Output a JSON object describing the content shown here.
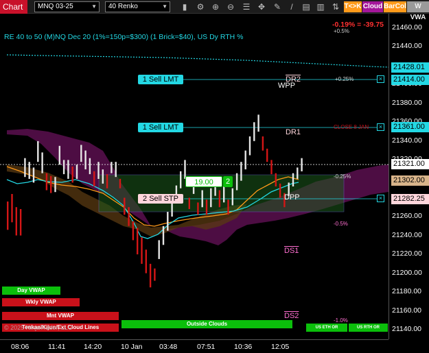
{
  "toolbar": {
    "chart_tab": "Chart",
    "instrument": "MNQ 03-25",
    "bar_type": "40 Renko",
    "buttons": [
      {
        "label": "T<>K",
        "color": "#ff9a1a"
      },
      {
        "label": "Cloud",
        "color": "#a4169a"
      },
      {
        "label": "BarCol",
        "color": "#ff9a1a"
      },
      {
        "label": "W VWA",
        "color": "#9a9a9a"
      }
    ]
  },
  "chart": {
    "title": "RE 40 to 50 (M)NQ Dec 20 (1%=150p=$300) (1 Brick=$40), US Dy RTH %",
    "pct_change": "-0.19% = -39.75",
    "plus_half": "+0.5%",
    "watermark": "© 2025 NinjaTrader, LLC",
    "orders": [
      {
        "label": "1 Sell LMT",
        "kind": "limit"
      },
      {
        "label": "1 Sell LMT",
        "kind": "limit"
      },
      {
        "label": "2 Sell STP",
        "kind": "stop"
      }
    ],
    "position": {
      "price": "19.00",
      "qty": "2"
    },
    "levels": {
      "dr2": "DR2",
      "wpp": "WPP",
      "dr1": "DR1",
      "dpp": "DPP",
      "ds1": "DS1",
      "ds2": "DS2"
    },
    "pct_labels": {
      "p025": "+0.25%",
      "close": "CLOSE 8 JAN",
      "m025": "-0.25%",
      "m05": "-0.5%",
      "m1": "-1.0%"
    },
    "legend_bars": [
      {
        "label": "Day VWAP",
        "color": "#0bbf0b"
      },
      {
        "label": "Wkly VWAP",
        "color": "#c9111a"
      },
      {
        "label": "Mnt VWAP",
        "color": "#c9111a"
      },
      {
        "label": "Tenkan/Kijun/Ext Cloud Lines",
        "color": "#c9111a"
      },
      {
        "label": "Outside Clouds",
        "color": "#0bbf0b"
      },
      {
        "label": "US ETH OR",
        "color": "#0bbf0b"
      },
      {
        "label": "US RTH OR",
        "color": "#0bbf0b"
      }
    ]
  },
  "price_axis": {
    "ticks": [
      "21460.00",
      "21440.00",
      "21420.00",
      "21400.00",
      "21380.00",
      "21360.00",
      "21340.00",
      "21320.00",
      "21300.00",
      "21280.00",
      "21260.00",
      "21240.00",
      "21220.00",
      "21200.00",
      "21180.00",
      "21160.00",
      "21140.00"
    ],
    "tags": [
      {
        "value": "21428.01",
        "color": "#23d8e4"
      },
      {
        "value": "21414.00",
        "color": "#23d8e4"
      },
      {
        "value": "21361.00",
        "color": "#23d8e4"
      },
      {
        "value": "21321.00",
        "color": "#ffffff"
      },
      {
        "value": "21302.00",
        "color": "#d8b48a"
      },
      {
        "value": "21282.25",
        "color": "#ffd6dc"
      }
    ]
  },
  "time_axis": {
    "labels": [
      "08:06",
      "11:41",
      "14:20",
      "10 Jan",
      "03:48",
      "07:51",
      "10:36",
      "12:05"
    ]
  },
  "chart_data": {
    "type": "candlestick",
    "ylim": [
      21130,
      21475
    ],
    "bricks": [
      {
        "o": 21276,
        "c": 21246,
        "up": false
      },
      {
        "o": 21284,
        "c": 21254,
        "up": false
      },
      {
        "o": 21270,
        "c": 21240,
        "up": false
      },
      {
        "o": 21268,
        "c": 21240,
        "up": false
      },
      {
        "o": 21302,
        "c": 21322,
        "up": true
      },
      {
        "o": 21300,
        "c": 21318,
        "up": true
      },
      {
        "o": 21296,
        "c": 21312,
        "up": true
      },
      {
        "o": 21318,
        "c": 21340,
        "up": true
      },
      {
        "o": 21306,
        "c": 21328,
        "up": true
      },
      {
        "o": 21288,
        "c": 21306,
        "up": false
      },
      {
        "o": 21285,
        "c": 21303,
        "up": false
      },
      {
        "o": 21286,
        "c": 21302,
        "up": true
      },
      {
        "o": 21315,
        "c": 21335,
        "up": true
      },
      {
        "o": 21305,
        "c": 21320,
        "up": true
      },
      {
        "o": 21300,
        "c": 21320,
        "up": true
      },
      {
        "o": 21296,
        "c": 21313,
        "up": false
      },
      {
        "o": 21300,
        "c": 21315,
        "up": true
      },
      {
        "o": 21318,
        "c": 21336,
        "up": true
      },
      {
        "o": 21310,
        "c": 21330,
        "up": true
      },
      {
        "o": 21305,
        "c": 21322,
        "up": true
      },
      {
        "o": 21292,
        "c": 21308,
        "up": false
      },
      {
        "o": 21300,
        "c": 21318,
        "up": true
      },
      {
        "o": 21295,
        "c": 21310,
        "up": true
      },
      {
        "o": 21290,
        "c": 21305,
        "up": false
      },
      {
        "o": 21306,
        "c": 21318,
        "up": true
      },
      {
        "o": 21302,
        "c": 21318,
        "up": true
      },
      {
        "o": 21300,
        "c": 21290,
        "up": false
      },
      {
        "o": 21280,
        "c": 21262,
        "up": false
      },
      {
        "o": 21270,
        "c": 21250,
        "up": false
      },
      {
        "o": 21255,
        "c": 21235,
        "up": false
      },
      {
        "o": 21248,
        "c": 21220,
        "up": false
      },
      {
        "o": 21238,
        "c": 21210,
        "up": false
      },
      {
        "o": 21225,
        "c": 21200,
        "up": false
      },
      {
        "o": 21210,
        "c": 21185,
        "up": false
      },
      {
        "o": 21205,
        "c": 21192,
        "up": false
      },
      {
        "o": 21215,
        "c": 21235,
        "up": true
      },
      {
        "o": 21230,
        "c": 21250,
        "up": true
      },
      {
        "o": 21245,
        "c": 21265,
        "up": true
      },
      {
        "o": 21260,
        "c": 21280,
        "up": true
      },
      {
        "o": 21275,
        "c": 21293,
        "up": true
      },
      {
        "o": 21290,
        "c": 21308,
        "up": true
      },
      {
        "o": 21300,
        "c": 21320,
        "up": true
      },
      {
        "o": 21280,
        "c": 21268,
        "up": false
      },
      {
        "o": 21284,
        "c": 21300,
        "up": true
      },
      {
        "o": 21275,
        "c": 21262,
        "up": false
      },
      {
        "o": 21270,
        "c": 21288,
        "up": true
      },
      {
        "o": 21278,
        "c": 21262,
        "up": false
      },
      {
        "o": 21270,
        "c": 21290,
        "up": true
      },
      {
        "o": 21282,
        "c": 21300,
        "up": true
      },
      {
        "o": 21288,
        "c": 21270,
        "up": false
      },
      {
        "o": 21275,
        "c": 21295,
        "up": true
      },
      {
        "o": 21278,
        "c": 21262,
        "up": false
      },
      {
        "o": 21272,
        "c": 21290,
        "up": true
      },
      {
        "o": 21288,
        "c": 21306,
        "up": true
      },
      {
        "o": 21298,
        "c": 21318,
        "up": true
      },
      {
        "o": 21310,
        "c": 21330,
        "up": true
      },
      {
        "o": 21325,
        "c": 21345,
        "up": true
      },
      {
        "o": 21340,
        "c": 21360,
        "up": true
      },
      {
        "o": 21350,
        "c": 21368,
        "up": true
      },
      {
        "o": 21345,
        "c": 21330,
        "up": false
      },
      {
        "o": 21332,
        "c": 21318,
        "up": false
      },
      {
        "o": 21320,
        "c": 21305,
        "up": false
      },
      {
        "o": 21306,
        "c": 21292,
        "up": false
      },
      {
        "o": 21295,
        "c": 21280,
        "up": false
      },
      {
        "o": 21285,
        "c": 21270,
        "up": false
      },
      {
        "o": 21282,
        "c": 21296,
        "up": true
      },
      {
        "o": 21292,
        "c": 21306,
        "up": true
      },
      {
        "o": 21300,
        "c": 21312,
        "up": true
      },
      {
        "o": 21308,
        "c": 21322,
        "up": true
      }
    ]
  }
}
